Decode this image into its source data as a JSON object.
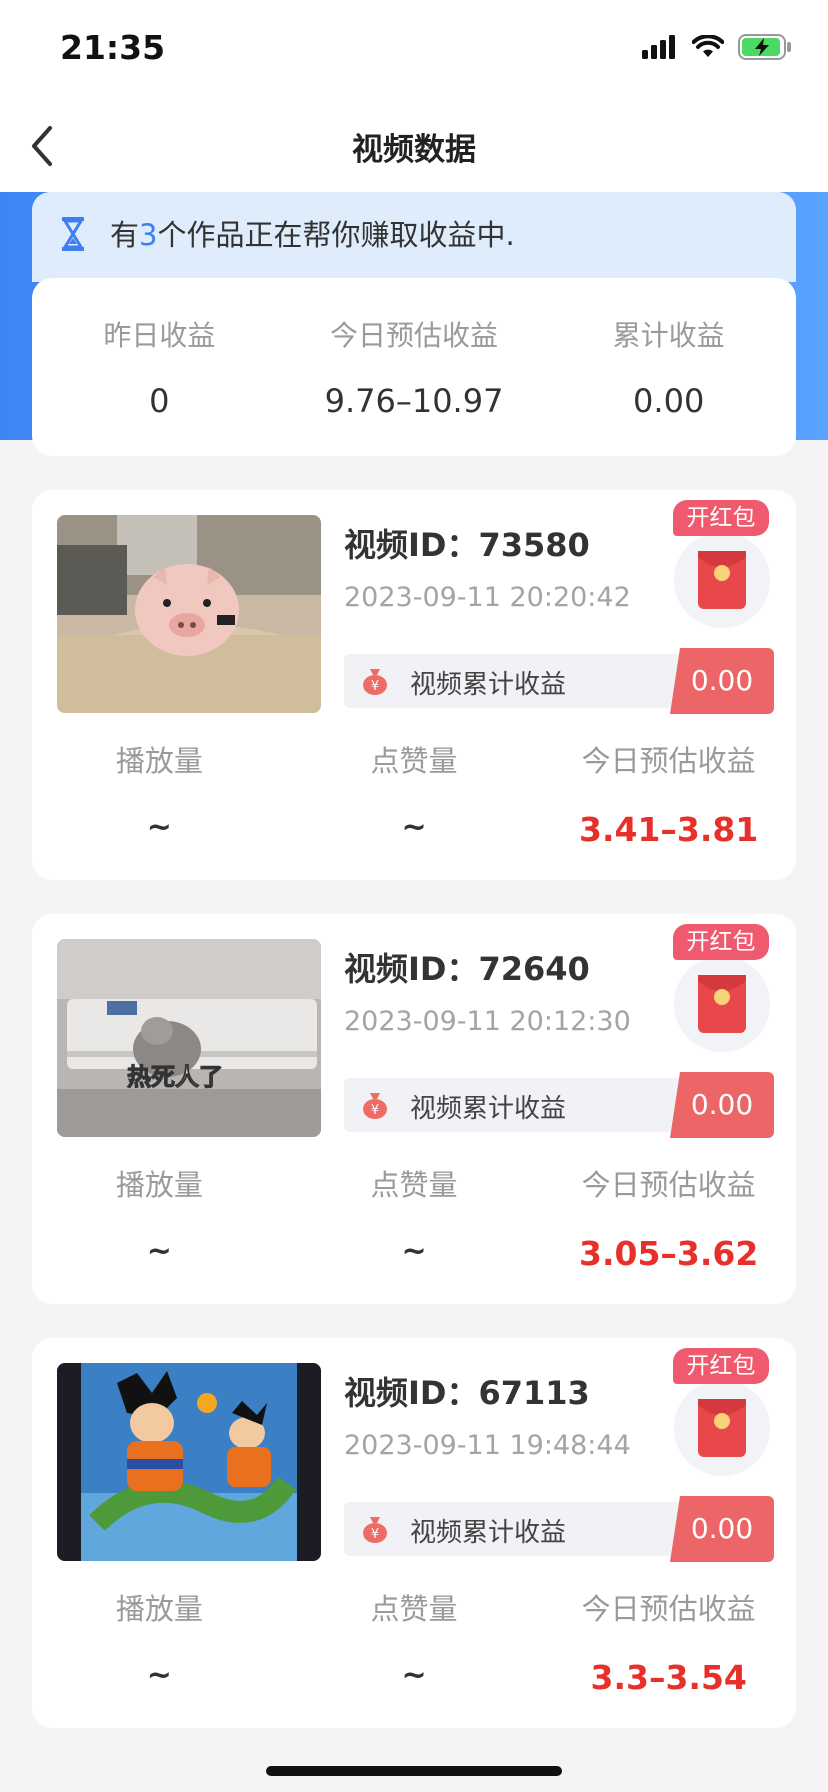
{
  "status_bar": {
    "time": "21:35"
  },
  "nav": {
    "title": "视频数据"
  },
  "notice": {
    "prefix": "有",
    "count": "3",
    "suffix": "个作品正在帮你赚取收益中."
  },
  "summary": {
    "items": [
      {
        "label": "昨日收益",
        "value": "0"
      },
      {
        "label": "今日预估收益",
        "value": "9.76–10.97"
      },
      {
        "label": "累计收益",
        "value": "0.00"
      }
    ]
  },
  "videos": [
    {
      "id_label": "视频ID：73580",
      "time": "2023-09-11 20:20:42",
      "badge": "开红包",
      "earn_label": "视频累计收益",
      "earn_value": "0.00",
      "stats": [
        {
          "label": "播放量",
          "value": "~"
        },
        {
          "label": "点赞量",
          "value": "~"
        },
        {
          "label": "今日预估收益",
          "value": "3.41–3.81"
        }
      ]
    },
    {
      "id_label": "视频ID：72640",
      "time": "2023-09-11 20:12:30",
      "badge": "开红包",
      "thumb_caption": "热死人了",
      "earn_label": "视频累计收益",
      "earn_value": "0.00",
      "stats": [
        {
          "label": "播放量",
          "value": "~"
        },
        {
          "label": "点赞量",
          "value": "~"
        },
        {
          "label": "今日预估收益",
          "value": "3.05–3.62"
        }
      ]
    },
    {
      "id_label": "视频ID：67113",
      "time": "2023-09-11 19:48:44",
      "badge": "开红包",
      "earn_label": "视频累计收益",
      "earn_value": "0.00",
      "stats": [
        {
          "label": "播放量",
          "value": "~"
        },
        {
          "label": "点赞量",
          "value": "~"
        },
        {
          "label": "今日预估收益",
          "value": "3.3–3.54"
        }
      ]
    }
  ],
  "colors": {
    "accent_blue": "#3d7ff0",
    "earning_red": "#e8302a",
    "badge_pink": "#ef5a6e"
  }
}
